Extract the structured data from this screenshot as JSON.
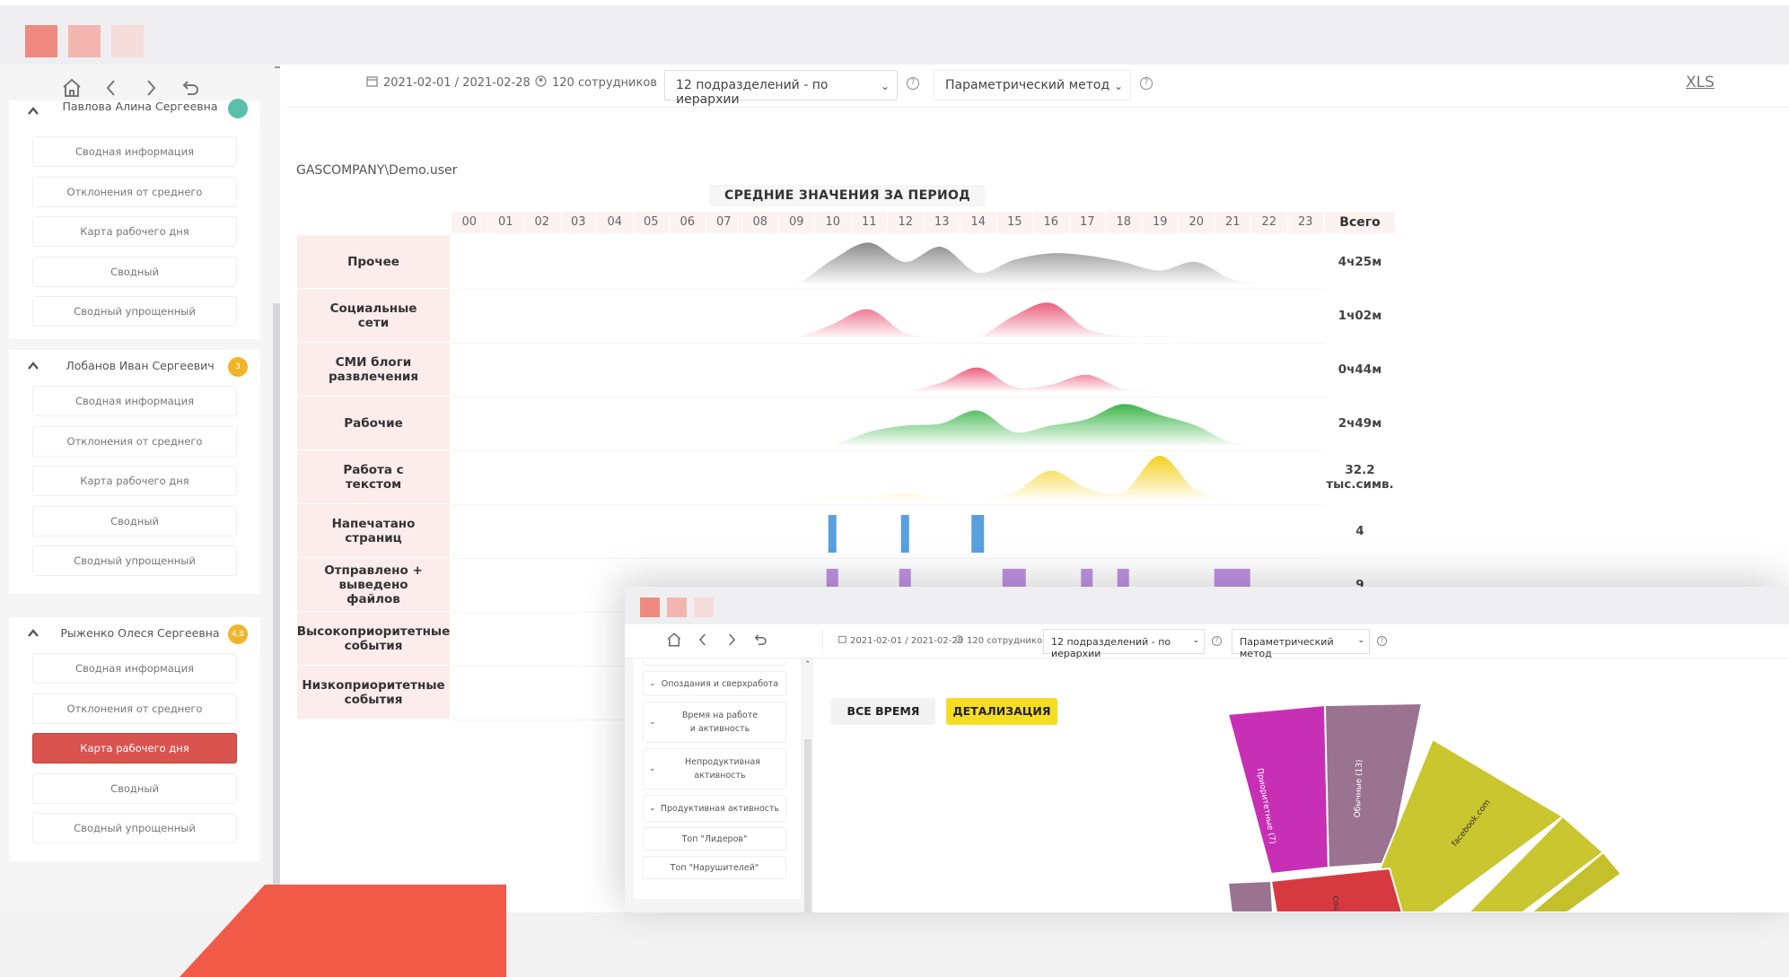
{
  "toolbar": {
    "date_range": "2021-02-01 / 2021-02-28",
    "employees": "120 сотрудников",
    "departments_select": "12 подразделений - по иерархии",
    "method_select": "Параметрический метод",
    "export_label": "XLS"
  },
  "user": "GASCOMPANY\\Demo.user",
  "sidebar": {
    "persons": [
      {
        "name": "Павлова Алина Сергеевна",
        "badge_color": "#5bc0a9",
        "items": [
          "Сводная информация",
          "Отклонения от среднего",
          "Карта рабочего дня",
          "Сводный",
          "Сводный упрощенный"
        ]
      },
      {
        "name": "Лобанов Иван Сергеевич",
        "badge": "3",
        "badge_color": "#f0b429",
        "items": [
          "Сводная информация",
          "Отклонения от среднего",
          "Карта рабочего дня",
          "Сводный",
          "Сводный упрощенный"
        ]
      },
      {
        "name": "Рыженко Олеся Сергеевна",
        "badge": "4,8",
        "badge_color": "#f0b429",
        "active_item": "Карта рабочего дня",
        "items": [
          "Сводная информация",
          "Отклонения от среднего",
          "Карта рабочего дня",
          "Сводный",
          "Сводный упрощенный"
        ]
      }
    ]
  },
  "chart_data": {
    "type": "area",
    "title": "СРЕДНИЕ ЗНАЧЕНИЯ ЗА ПЕРИОД",
    "x": [
      "00",
      "01",
      "02",
      "03",
      "04",
      "05",
      "06",
      "07",
      "08",
      "09",
      "10",
      "11",
      "12",
      "13",
      "14",
      "15",
      "16",
      "17",
      "18",
      "19",
      "20",
      "21",
      "22",
      "23"
    ],
    "total_header": "Всего",
    "series": [
      {
        "name": "Прочее",
        "color": "#8a8a8a",
        "total": "4ч25м",
        "values": [
          0,
          0,
          0,
          0,
          0,
          0,
          0,
          0,
          0,
          0,
          0.55,
          0.95,
          0.5,
          0.85,
          0.25,
          0.55,
          0.7,
          0.65,
          0.5,
          0.3,
          0.5,
          0.1,
          0,
          0
        ]
      },
      {
        "name": "Социальные сети",
        "color": "#ec5f7e",
        "total": "1ч02м",
        "values": [
          0,
          0,
          0,
          0,
          0,
          0,
          0,
          0,
          0,
          0,
          0.3,
          0.65,
          0.1,
          0,
          0,
          0.5,
          0.8,
          0.2,
          0.03,
          0.03,
          0,
          0,
          0,
          0
        ]
      },
      {
        "name": "СМИ блоги развлечения",
        "color": "#ec5f7e",
        "total": "0ч44м",
        "values": [
          0,
          0,
          0,
          0,
          0,
          0,
          0,
          0,
          0,
          0,
          0,
          0,
          0,
          0.2,
          0.55,
          0.1,
          0.15,
          0.38,
          0.05,
          0,
          0,
          0,
          0,
          0
        ]
      },
      {
        "name": "Рабочие",
        "color": "#3cb54a",
        "total": "2ч49м",
        "values": [
          0,
          0,
          0,
          0,
          0,
          0,
          0,
          0,
          0,
          0,
          0,
          0.3,
          0.45,
          0.5,
          0.8,
          0.3,
          0.45,
          0.6,
          0.95,
          0.7,
          0.45,
          0.05,
          0,
          0
        ]
      },
      {
        "name": "Работа с текстом",
        "color": "#f2d11c",
        "total": "32.2 тыс.симв.",
        "values": [
          0,
          0,
          0,
          0,
          0,
          0,
          0,
          0,
          0,
          0,
          0.05,
          0.05,
          0.12,
          0.03,
          0,
          0.15,
          0.65,
          0.25,
          0.15,
          1.0,
          0.2,
          0,
          0,
          0
        ]
      },
      {
        "name": "Напечатано страниц",
        "color": "#3b8fd9",
        "total": "4",
        "type": "bar",
        "values": [
          0,
          0,
          0,
          0,
          0,
          0,
          0,
          0,
          0,
          0,
          1,
          0,
          1,
          0,
          1,
          0,
          0,
          0,
          0,
          0,
          0,
          0,
          0,
          0
        ]
      },
      {
        "name": "Отправлено + выведено файлов",
        "color": "#b57fde",
        "total": "9",
        "type": "bar",
        "values": [
          0,
          0,
          0,
          0,
          0,
          0,
          0,
          0,
          0,
          0,
          1,
          0,
          1,
          0,
          0,
          1,
          0,
          1,
          1,
          0,
          0,
          1,
          0,
          0
        ]
      },
      {
        "name": "Высокоприоритетные события",
        "color": "#d9534f",
        "total": "",
        "values": []
      },
      {
        "name": "Низкоприоритетные события",
        "color": "#d9534f",
        "total": "",
        "values": []
      }
    ]
  },
  "overlay": {
    "date_range": "2021-02-01 / 2021-02-28",
    "employees": "120 сотрудников",
    "departments_select": "12 подразделений - по иерархии",
    "method_select": "Параметрический метод",
    "menu_items": [
      "Опоздания и сверхработа",
      "Время на работе и активность",
      "Непродуктивная активность",
      "Продуктивная активность",
      "Топ \"Лидеров\"",
      "Топ \"Нарушителей\""
    ],
    "btn_all": "ВСЕ ВРЕМЯ",
    "btn_detail": "ДЕТАЛИЗАЦИЯ",
    "sunburst_labels": [
      "Приоритетные (7)",
      "Обычные (13)",
      "facebook.com",
      "Соц"
    ],
    "sunburst_colors": [
      "#c730b5",
      "#9a7391",
      "#c9c62f",
      "#d63a40"
    ]
  },
  "colors": {
    "accent_red": "#d9534f",
    "accent_yellow": "#f5dd24",
    "deco_orange": "#f05a47"
  }
}
